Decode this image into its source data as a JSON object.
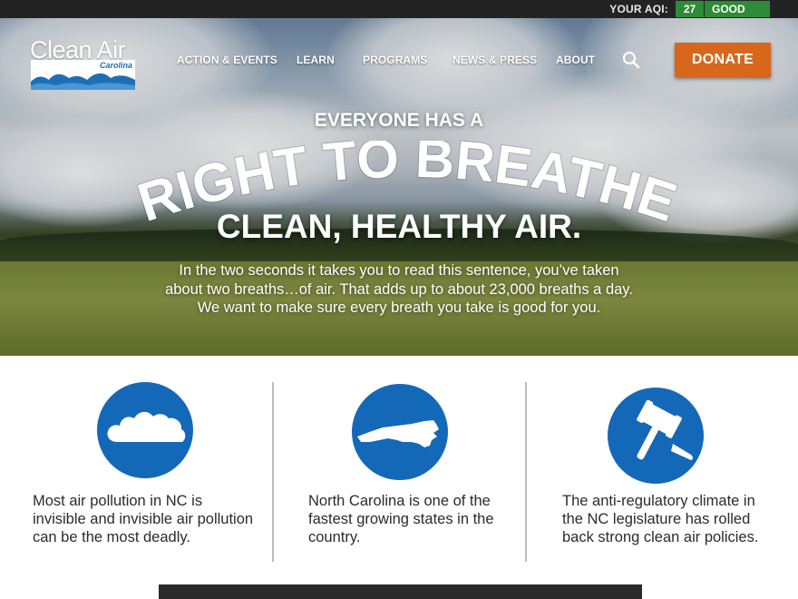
{
  "aqi": {
    "label": "YOUR AQI:",
    "value": "27",
    "status": "GOOD",
    "color": "#2e8b37"
  },
  "logo": {
    "title": "Clean Air",
    "subtitle": "Carolina",
    "color": "#1e6fb5"
  },
  "nav": {
    "items": [
      "ACTION & EVENTS",
      "LEARN",
      "PROGRAMS",
      "NEWS & PRESS",
      "ABOUT"
    ],
    "search_icon": "search-icon",
    "donate_label": "DONATE",
    "donate_color": "#d8661b"
  },
  "hero": {
    "line1": "EVERYONE HAS A",
    "line2": "RIGHT TO BREATHE",
    "line3": "CLEAN, HEALTHY AIR.",
    "body_lines": [
      "In the two seconds it takes you to read this sentence, you’ve taken",
      "about two breaths…of air. That adds up to about 23,000 breaths a day.",
      "We want to make sure every breath you take is good for you."
    ]
  },
  "features": [
    {
      "icon": "cloud-icon",
      "lines": [
        "Most air pollution in NC is",
        "invisible and invisible air pollution",
        "can be the most deadly."
      ]
    },
    {
      "icon": "north-carolina-map-icon",
      "lines": [
        "North Carolina is one of the",
        "fastest growing states in the",
        "country."
      ]
    },
    {
      "icon": "gavel-icon",
      "lines": [
        "The anti-regulatory climate in",
        "the NC legislature has rolled",
        "back strong clean air policies."
      ]
    }
  ],
  "accent_color": "#1468b8"
}
